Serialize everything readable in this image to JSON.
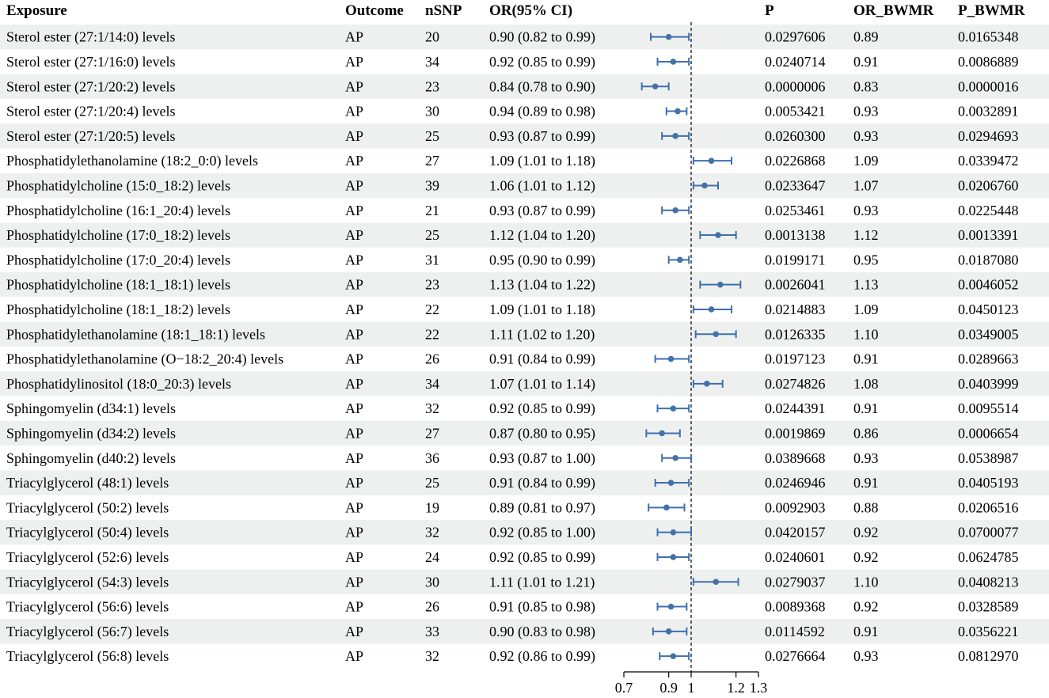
{
  "headers": [
    "Exposure",
    "Outcome",
    "nSNP",
    "OR(95% CI)",
    "P",
    "OR_BWMR",
    "P_BWMR"
  ],
  "colors": {
    "stripe": "#eef0ef",
    "point": "#4472a8",
    "ci": "#3d6fb0",
    "axis": "#000000"
  },
  "chart_data": {
    "type": "forest",
    "xlim": [
      0.7,
      1.3
    ],
    "ticks": [
      0.7,
      0.9,
      1,
      1.2,
      1.3
    ],
    "tick_labels": [
      "0.7",
      "0.9",
      "1",
      "1.2",
      "1.3"
    ],
    "reference_line": 1,
    "rows": [
      {
        "exposure": "Sterol ester (27:1/14:0) levels",
        "outcome": "AP",
        "nsnp": "20",
        "or_ci": "0.90 (0.82 to 0.99)",
        "or": 0.9,
        "lo": 0.82,
        "hi": 0.99,
        "p": "0.0297606",
        "or_bwmr": "0.89",
        "p_bwmr": "0.0165348"
      },
      {
        "exposure": "Sterol ester (27:1/16:0) levels",
        "outcome": "AP",
        "nsnp": "34",
        "or_ci": "0.92 (0.85 to 0.99)",
        "or": 0.92,
        "lo": 0.85,
        "hi": 0.99,
        "p": "0.0240714",
        "or_bwmr": "0.91",
        "p_bwmr": "0.0086889"
      },
      {
        "exposure": "Sterol ester (27:1/20:2) levels",
        "outcome": "AP",
        "nsnp": "23",
        "or_ci": "0.84 (0.78 to 0.90)",
        "or": 0.84,
        "lo": 0.78,
        "hi": 0.9,
        "p": "0.0000006",
        "or_bwmr": "0.83",
        "p_bwmr": "0.0000016"
      },
      {
        "exposure": "Sterol ester (27:1/20:4) levels",
        "outcome": "AP",
        "nsnp": "30",
        "or_ci": "0.94 (0.89 to 0.98)",
        "or": 0.94,
        "lo": 0.89,
        "hi": 0.98,
        "p": "0.0053421",
        "or_bwmr": "0.93",
        "p_bwmr": "0.0032891"
      },
      {
        "exposure": "Sterol ester (27:1/20:5) levels",
        "outcome": "AP",
        "nsnp": "25",
        "or_ci": "0.93 (0.87 to 0.99)",
        "or": 0.93,
        "lo": 0.87,
        "hi": 0.99,
        "p": "0.0260300",
        "or_bwmr": "0.93",
        "p_bwmr": "0.0294693"
      },
      {
        "exposure": "Phosphatidylethanolamine (18:2_0:0) levels",
        "outcome": "AP",
        "nsnp": "27",
        "or_ci": "1.09 (1.01 to 1.18)",
        "or": 1.09,
        "lo": 1.01,
        "hi": 1.18,
        "p": "0.0226868",
        "or_bwmr": "1.09",
        "p_bwmr": "0.0339472"
      },
      {
        "exposure": "Phosphatidylcholine (15:0_18:2) levels",
        "outcome": "AP",
        "nsnp": "39",
        "or_ci": "1.06 (1.01 to 1.12)",
        "or": 1.06,
        "lo": 1.01,
        "hi": 1.12,
        "p": "0.0233647",
        "or_bwmr": "1.07",
        "p_bwmr": "0.0206760"
      },
      {
        "exposure": "Phosphatidylcholine (16:1_20:4) levels",
        "outcome": "AP",
        "nsnp": "21",
        "or_ci": "0.93 (0.87 to 0.99)",
        "or": 0.93,
        "lo": 0.87,
        "hi": 0.99,
        "p": "0.0253461",
        "or_bwmr": "0.93",
        "p_bwmr": "0.0225448"
      },
      {
        "exposure": "Phosphatidylcholine (17:0_18:2) levels",
        "outcome": "AP",
        "nsnp": "25",
        "or_ci": "1.12 (1.04 to 1.20)",
        "or": 1.12,
        "lo": 1.04,
        "hi": 1.2,
        "p": "0.0013138",
        "or_bwmr": "1.12",
        "p_bwmr": "0.0013391"
      },
      {
        "exposure": "Phosphatidylcholine (17:0_20:4) levels",
        "outcome": "AP",
        "nsnp": "31",
        "or_ci": "0.95 (0.90 to 0.99)",
        "or": 0.95,
        "lo": 0.9,
        "hi": 0.99,
        "p": "0.0199171",
        "or_bwmr": "0.95",
        "p_bwmr": "0.0187080"
      },
      {
        "exposure": "Phosphatidylcholine (18:1_18:1) levels",
        "outcome": "AP",
        "nsnp": "23",
        "or_ci": "1.13 (1.04 to 1.22)",
        "or": 1.13,
        "lo": 1.04,
        "hi": 1.22,
        "p": "0.0026041",
        "or_bwmr": "1.13",
        "p_bwmr": "0.0046052"
      },
      {
        "exposure": "Phosphatidylcholine (18:1_18:2) levels",
        "outcome": "AP",
        "nsnp": "22",
        "or_ci": "1.09 (1.01 to 1.18)",
        "or": 1.09,
        "lo": 1.01,
        "hi": 1.18,
        "p": "0.0214883",
        "or_bwmr": "1.09",
        "p_bwmr": "0.0450123"
      },
      {
        "exposure": "Phosphatidylethanolamine (18:1_18:1) levels",
        "outcome": "AP",
        "nsnp": "22",
        "or_ci": "1.11 (1.02 to 1.20)",
        "or": 1.11,
        "lo": 1.02,
        "hi": 1.2,
        "p": "0.0126335",
        "or_bwmr": "1.10",
        "p_bwmr": "0.0349005"
      },
      {
        "exposure": "Phosphatidylethanolamine (O−18:2_20:4) levels",
        "outcome": "AP",
        "nsnp": "26",
        "or_ci": "0.91 (0.84 to 0.99)",
        "or": 0.91,
        "lo": 0.84,
        "hi": 0.99,
        "p": "0.0197123",
        "or_bwmr": "0.91",
        "p_bwmr": "0.0289663"
      },
      {
        "exposure": "Phosphatidylinositol (18:0_20:3) levels",
        "outcome": "AP",
        "nsnp": "34",
        "or_ci": "1.07 (1.01 to 1.14)",
        "or": 1.07,
        "lo": 1.01,
        "hi": 1.14,
        "p": "0.0274826",
        "or_bwmr": "1.08",
        "p_bwmr": "0.0403999"
      },
      {
        "exposure": "Sphingomyelin (d34:1) levels",
        "outcome": "AP",
        "nsnp": "32",
        "or_ci": "0.92 (0.85 to 0.99)",
        "or": 0.92,
        "lo": 0.85,
        "hi": 0.99,
        "p": "0.0244391",
        "or_bwmr": "0.91",
        "p_bwmr": "0.0095514"
      },
      {
        "exposure": "Sphingomyelin (d34:2) levels",
        "outcome": "AP",
        "nsnp": "27",
        "or_ci": "0.87 (0.80 to 0.95)",
        "or": 0.87,
        "lo": 0.8,
        "hi": 0.95,
        "p": "0.0019869",
        "or_bwmr": "0.86",
        "p_bwmr": "0.0006654"
      },
      {
        "exposure": "Sphingomyelin (d40:2) levels",
        "outcome": "AP",
        "nsnp": "36",
        "or_ci": "0.93 (0.87 to 1.00)",
        "or": 0.93,
        "lo": 0.87,
        "hi": 1.0,
        "p": "0.0389668",
        "or_bwmr": "0.93",
        "p_bwmr": "0.0538987"
      },
      {
        "exposure": "Triacylglycerol (48:1) levels",
        "outcome": "AP",
        "nsnp": "25",
        "or_ci": "0.91 (0.84 to 0.99)",
        "or": 0.91,
        "lo": 0.84,
        "hi": 0.99,
        "p": "0.0246946",
        "or_bwmr": "0.91",
        "p_bwmr": "0.0405193"
      },
      {
        "exposure": "Triacylglycerol (50:2) levels",
        "outcome": "AP",
        "nsnp": "19",
        "or_ci": "0.89 (0.81 to 0.97)",
        "or": 0.89,
        "lo": 0.81,
        "hi": 0.97,
        "p": "0.0092903",
        "or_bwmr": "0.88",
        "p_bwmr": "0.0206516"
      },
      {
        "exposure": "Triacylglycerol (50:4) levels",
        "outcome": "AP",
        "nsnp": "32",
        "or_ci": "0.92 (0.85 to 1.00)",
        "or": 0.92,
        "lo": 0.85,
        "hi": 1.0,
        "p": "0.0420157",
        "or_bwmr": "0.92",
        "p_bwmr": "0.0700077"
      },
      {
        "exposure": "Triacylglycerol (52:6) levels",
        "outcome": "AP",
        "nsnp": "24",
        "or_ci": "0.92 (0.85 to 0.99)",
        "or": 0.92,
        "lo": 0.85,
        "hi": 0.99,
        "p": "0.0240601",
        "or_bwmr": "0.92",
        "p_bwmr": "0.0624785"
      },
      {
        "exposure": "Triacylglycerol (54:3) levels",
        "outcome": "AP",
        "nsnp": "30",
        "or_ci": "1.11 (1.01 to 1.21)",
        "or": 1.11,
        "lo": 1.01,
        "hi": 1.21,
        "p": "0.0279037",
        "or_bwmr": "1.10",
        "p_bwmr": "0.0408213"
      },
      {
        "exposure": "Triacylglycerol (56:6) levels",
        "outcome": "AP",
        "nsnp": "26",
        "or_ci": "0.91 (0.85 to 0.98)",
        "or": 0.91,
        "lo": 0.85,
        "hi": 0.98,
        "p": "0.0089368",
        "or_bwmr": "0.92",
        "p_bwmr": "0.0328589"
      },
      {
        "exposure": "Triacylglycerol (56:7) levels",
        "outcome": "AP",
        "nsnp": "33",
        "or_ci": "0.90 (0.83 to 0.98)",
        "or": 0.9,
        "lo": 0.83,
        "hi": 0.98,
        "p": "0.0114592",
        "or_bwmr": "0.91",
        "p_bwmr": "0.0356221"
      },
      {
        "exposure": "Triacylglycerol (56:8) levels",
        "outcome": "AP",
        "nsnp": "32",
        "or_ci": "0.92 (0.86 to 0.99)",
        "or": 0.92,
        "lo": 0.86,
        "hi": 0.99,
        "p": "0.0276664",
        "or_bwmr": "0.93",
        "p_bwmr": "0.0812970"
      }
    ]
  }
}
